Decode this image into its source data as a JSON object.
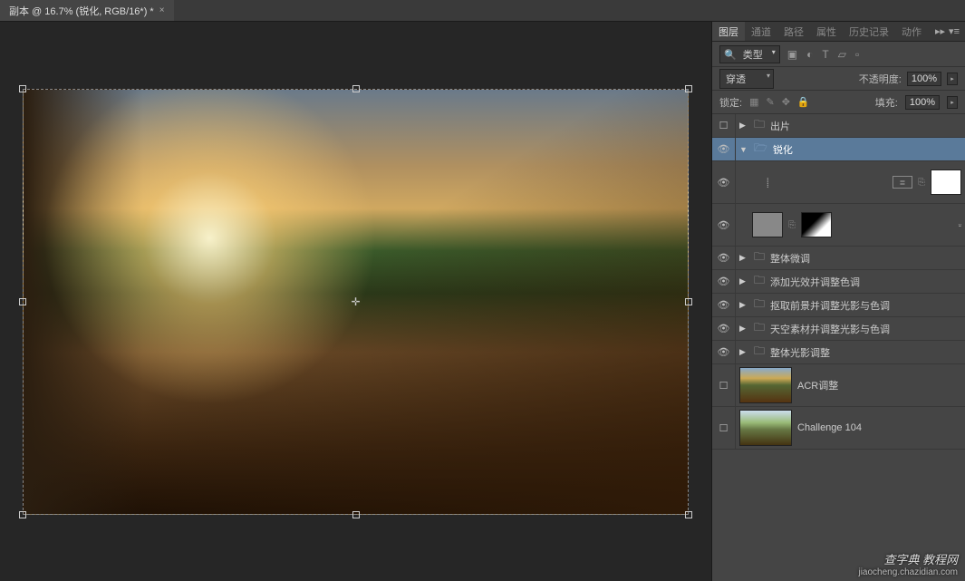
{
  "tab": {
    "title": "副本 @ 16.7% (锐化, RGB/16*) *",
    "close": "×"
  },
  "panel_tabs": [
    "图层",
    "通道",
    "路径",
    "属性",
    "历史记录",
    "动作"
  ],
  "panel_menu": {
    "arrows": "▸▸",
    "menu": "▾≡"
  },
  "filter": {
    "search_icon": "🔍",
    "type_label": "类型",
    "chev": "▾"
  },
  "filter_icons": {
    "image": "▣",
    "adjust": "◐",
    "text": "T",
    "shape": "▱",
    "smart": "▫"
  },
  "blend": {
    "mode": "穿透",
    "opacity_label": "不透明度:",
    "opacity_value": "100%"
  },
  "lock": {
    "label": "锁定:",
    "fill_label": "填充:",
    "fill_value": "100%",
    "icons": {
      "pixel": "▦",
      "brush": "✎",
      "move": "✥",
      "lock": "🔒"
    }
  },
  "layers": {
    "group_output": "出片",
    "group_sharpen": "锐化",
    "group_overall_fine": "整体微调",
    "group_glow": "添加光效并调整色调",
    "group_fg": "抠取前景并调整光影与色调",
    "group_sky": "天空素材并调整光影与色调",
    "group_light": "整体光影调整",
    "acr": "ACR调整",
    "challenge": "Challenge 104"
  },
  "eye": "👁",
  "watermark": {
    "main": "查字典 教程网",
    "sub": "jiaocheng.chazidian.com"
  }
}
